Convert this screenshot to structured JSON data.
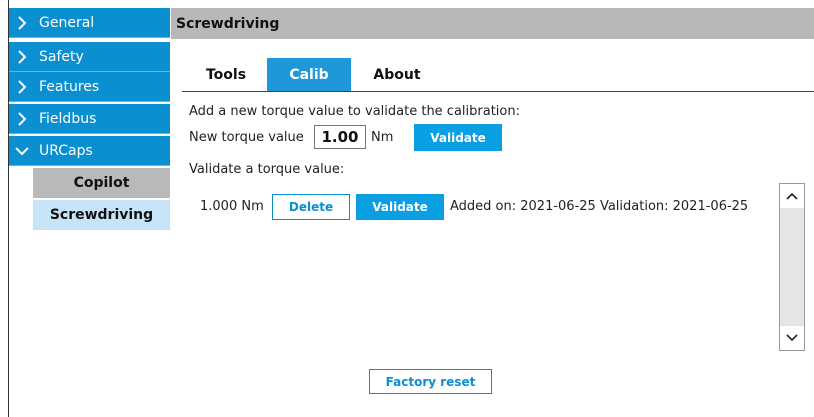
{
  "sidebar": {
    "items": [
      {
        "label": "General",
        "icon": "chevron-right-icon"
      },
      {
        "label": "Safety",
        "icon": "chevron-right-icon"
      },
      {
        "label": "Features",
        "icon": "chevron-right-icon"
      },
      {
        "label": "Fieldbus",
        "icon": "chevron-right-icon"
      },
      {
        "label": "URCaps",
        "icon": "chevron-down-icon"
      }
    ],
    "sub_items": [
      {
        "label": "Copilot"
      },
      {
        "label": "Screwdriving",
        "selected": true
      }
    ]
  },
  "main": {
    "title": "Screwdriving",
    "tabs": [
      {
        "label": "Tools"
      },
      {
        "label": "Calib",
        "active": true
      },
      {
        "label": "About"
      }
    ],
    "add_prompt": "Add a new torque value to validate the calibration:",
    "new_torque_label": "New torque value",
    "new_torque_value": "1.00",
    "new_torque_unit": "Nm",
    "validate_label": "Validate",
    "validate_prompt": "Validate a torque value:",
    "entries": [
      {
        "value": "1.000 Nm",
        "delete_label": "Delete",
        "validate_label": "Validate",
        "info": "Added on: 2021-06-25 Validation: 2021-06-25"
      }
    ],
    "factory_reset_label": "Factory reset"
  },
  "colors": {
    "accent": "#0a9ee3",
    "nav_bg": "#0a8fd1",
    "title_bg": "#b8b8b8",
    "selected_sub_bg": "#c7e3f7"
  }
}
